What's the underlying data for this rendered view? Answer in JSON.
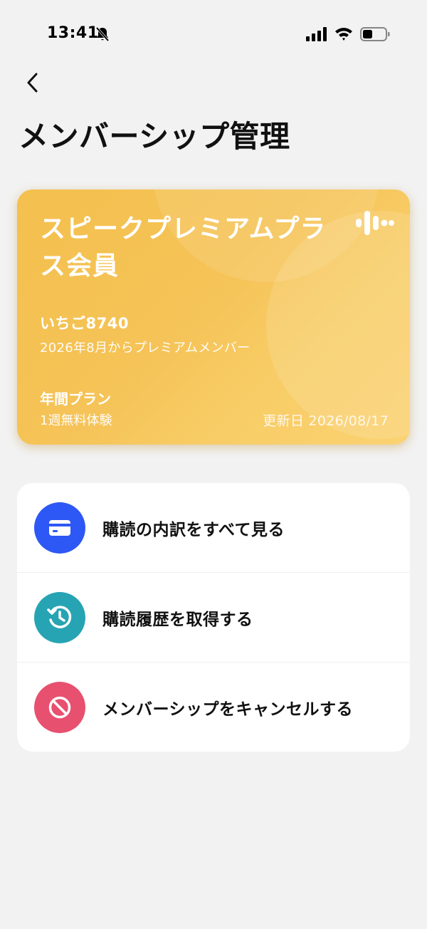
{
  "status_bar": {
    "time": "13:41"
  },
  "header": {
    "back_icon": "chevron-left-icon",
    "title": "メンバーシップ管理"
  },
  "card": {
    "title": "スピークプレミアムプラス会員",
    "username": "いちご8740",
    "member_since": "2026年8月からプレミアムメンバー",
    "plan": "年間プラン",
    "trial": "1週無料体験",
    "renewal": "更新日 2026/08/17",
    "logo_icon": "speak-waveform-logo",
    "color": "#f5c357"
  },
  "menu": {
    "items": [
      {
        "label": "購読の内訳をすべて見る",
        "icon": "credit-card-icon",
        "color": "#2d58f5"
      },
      {
        "label": "購読履歴を取得する",
        "icon": "history-icon",
        "color": "#27a4b3"
      },
      {
        "label": "メンバーシップをキャンセルする",
        "icon": "cancel-icon",
        "color": "#e8506f"
      }
    ]
  }
}
